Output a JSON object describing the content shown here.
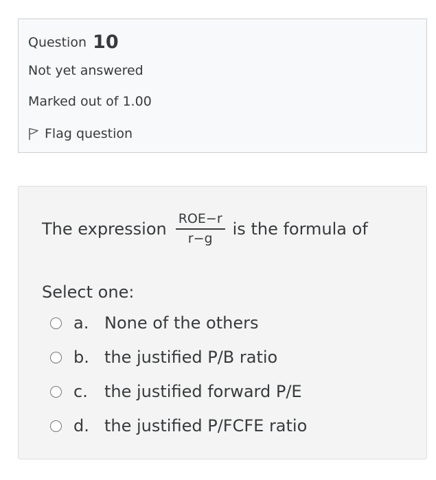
{
  "info": {
    "question_label": "Question",
    "question_number": "10",
    "state": "Not yet answered",
    "grade": "Marked out of 1.00",
    "flag_label": "Flag question"
  },
  "question": {
    "text_before": "The expression",
    "fraction_numerator": "ROE−r",
    "fraction_denominator": "r−g",
    "text_after": "is the formula of",
    "prompt": "Select one:"
  },
  "options": [
    {
      "letter": "a.",
      "text": "None of the others"
    },
    {
      "letter": "b.",
      "text": "the justified P/B ratio"
    },
    {
      "letter": "c.",
      "text": "the justified forward P/E"
    },
    {
      "letter": "d.",
      "text": "the justified P/FCFE ratio"
    }
  ]
}
